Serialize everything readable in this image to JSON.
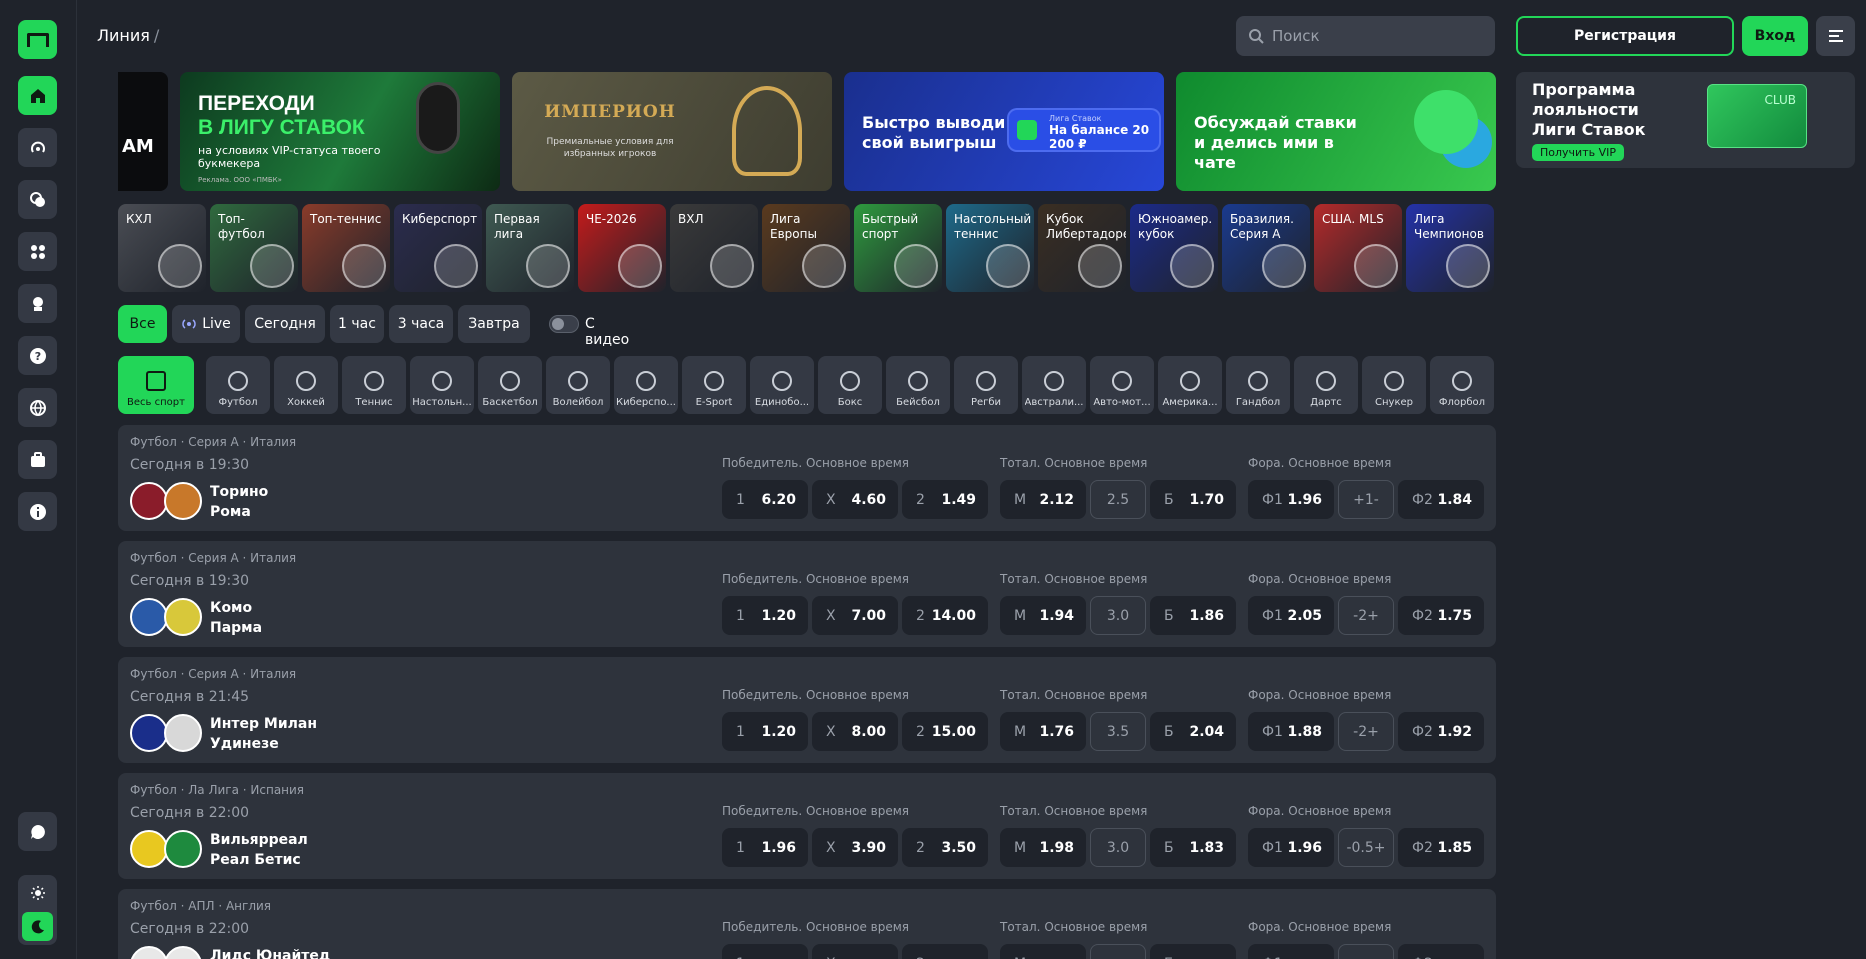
{
  "topbar": {
    "title": "Линия",
    "slash": "/",
    "search_placeholder": "Поиск",
    "register": "Регистрация",
    "login": "Вход"
  },
  "banners": {
    "b0_text": "АМ",
    "b1_line1": "Переходи",
    "b1_line2": "в Лигу Ставок",
    "b1_small": "на условиях VIP-статуса твоего букмекера",
    "b1_tiny": "Реклама. ООО «ПМБК»",
    "b2_brand": "ИМПЕРИОН",
    "b2_sub": "Премиальные условия для избранных игроков",
    "b3_text": "Быстро выводи свой выигрыш",
    "b3_card_label": "Лига Ставок",
    "b3_card_value": "На балансе 20 200 ₽",
    "b4_text": "Обсуждай ставки и делись ими в чате"
  },
  "loyalty": {
    "title": "Программа лояльности Лиги Ставок",
    "button": "Получить VIP",
    "card": "CLUB"
  },
  "leagues": [
    {
      "label": "КХЛ",
      "color": "#4a4d54"
    },
    {
      "label": "Топ-футбол",
      "color": "#2f6a3e"
    },
    {
      "label": "Топ-теннис",
      "color": "#8a3b2a"
    },
    {
      "label": "Киберспорт",
      "color": "#2b2c4e"
    },
    {
      "label": "Первая лига",
      "color": "#3f5a52"
    },
    {
      "label": "ЧЕ-2026",
      "color": "#c41b1b"
    },
    {
      "label": "ВХЛ",
      "color": "#3a3a3a"
    },
    {
      "label": "Лига Европы",
      "color": "#5a3a1e"
    },
    {
      "label": "Быстрый спорт",
      "color": "#2e9a3e"
    },
    {
      "label": "Настольный теннис",
      "color": "#1e6a8a"
    },
    {
      "label": "Кубок Либертадорес",
      "color": "#3a2e22"
    },
    {
      "label": "Южноамер. кубок",
      "color": "#1b2a8a"
    },
    {
      "label": "Бразилия. Серия А",
      "color": "#1a3a8e"
    },
    {
      "label": "США. MLS",
      "color": "#b52a2a"
    },
    {
      "label": "Лига Чемпионов",
      "color": "#2432a8"
    }
  ],
  "time_filters": {
    "all": "Все",
    "live": "Live",
    "today": "Сегодня",
    "h1": "1 час",
    "h3": "3 часа",
    "tomorrow": "Завтра",
    "video": "С видео"
  },
  "sports": [
    "Весь спорт",
    "Футбол",
    "Хоккей",
    "Теннис",
    "Настольн...",
    "Баскетбол",
    "Волейбол",
    "Киберспо...",
    "E-Sport",
    "Единобо...",
    "Бокс",
    "Бейсбол",
    "Регби",
    "Австрали...",
    "Авто-мот...",
    "Америка...",
    "Гандбол",
    "Дартс",
    "Снукер",
    "Флорбол"
  ],
  "markets": {
    "winner": "Победитель. Основное время",
    "total": "Тотал. Основное время",
    "handicap": "Фора. Основное время"
  },
  "matches": [
    {
      "league": "Футбол · Серия А · Италия",
      "time": "Сегодня в 19:30",
      "home": "Торино",
      "away": "Рома",
      "c1": "#8a1c2a",
      "c2": "#c8782a",
      "w1": "6.20",
      "x": "4.60",
      "w2": "1.49",
      "tm": "2.12",
      "tl": "2.5",
      "tb": "1.70",
      "f1": "1.96",
      "fl": "+1-",
      "f2": "1.84"
    },
    {
      "league": "Футбол · Серия А · Италия",
      "time": "Сегодня в 19:30",
      "home": "Комо",
      "away": "Парма",
      "c1": "#2a5aa8",
      "c2": "#d8c83a",
      "w1": "1.20",
      "x": "7.00",
      "w2": "14.00",
      "tm": "1.94",
      "tl": "3.0",
      "tb": "1.86",
      "f1": "2.05",
      "fl": "-2+",
      "f2": "1.75"
    },
    {
      "league": "Футбол · Серия А · Италия",
      "time": "Сегодня в 21:45",
      "home": "Интер Милан",
      "away": "Удинезе",
      "c1": "#1a2e8a",
      "c2": "#d8d8d8",
      "w1": "1.20",
      "x": "8.00",
      "w2": "15.00",
      "tm": "1.76",
      "tl": "3.5",
      "tb": "2.04",
      "f1": "1.88",
      "fl": "-2+",
      "f2": "1.92"
    },
    {
      "league": "Футбол · Ла Лига · Испания",
      "time": "Сегодня в 22:00",
      "home": "Вильярреал",
      "away": "Реал Бетис",
      "c1": "#e8c820",
      "c2": "#1e8a3e",
      "w1": "1.96",
      "x": "3.90",
      "w2": "3.50",
      "tm": "1.98",
      "tl": "3.0",
      "tb": "1.83",
      "f1": "1.96",
      "fl": "-0.5+",
      "f2": "1.85"
    },
    {
      "league": "Футбол · АПЛ · Англия",
      "time": "Сегодня в 22:00",
      "home": "Лидс Юнайтед",
      "away": "",
      "c1": "#e8e8e8",
      "c2": "#e8e8e8",
      "w1": "",
      "x": "",
      "w2": "",
      "tm": "",
      "tl": "",
      "tb": "",
      "f1": "",
      "fl": "",
      "f2": ""
    }
  ],
  "labels": {
    "one": "1",
    "x": "X",
    "two": "2",
    "m": "М",
    "b": "Б",
    "f1": "Ф1",
    "f2": "Ф2"
  },
  "colors": {
    "accent": "#22d658",
    "bg": "#1f232b",
    "card": "#2e333c",
    "chip": "#343944"
  }
}
